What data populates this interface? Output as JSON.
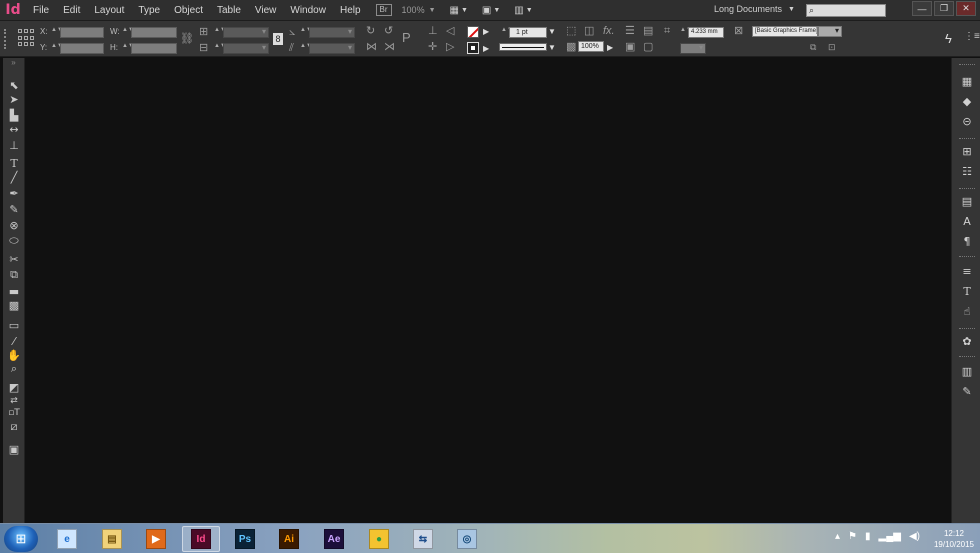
{
  "app": {
    "logo": "Id",
    "menu": [
      "File",
      "Edit",
      "Layout",
      "Type",
      "Object",
      "Table",
      "View",
      "Window",
      "Help"
    ],
    "bridge_label": "Br",
    "zoom": "100%",
    "workspace": "Long Documents",
    "search_placeholder": ""
  },
  "controlbar": {
    "x_label": "X:",
    "y_label": "Y:",
    "w_label": "W:",
    "h_label": "H:",
    "stroke_weight": "1 pt",
    "opacity": "100%",
    "fitting_value": "4.233 mm",
    "object_style": "[Basic Graphics Frame]"
  },
  "window_controls": {
    "minimize": "—",
    "restore": "❐",
    "close": "✕"
  },
  "taskbar": {
    "apps": [
      {
        "name": "internet-explorer",
        "label": "e",
        "color": "#1e6fd0",
        "bg": "#cfe6ff"
      },
      {
        "name": "file-explorer",
        "label": "▤",
        "color": "#7a5a12",
        "bg": "#f1d27a"
      },
      {
        "name": "media-player",
        "label": "▶",
        "color": "#ffffff",
        "bg": "#e06a1b"
      },
      {
        "name": "indesign",
        "label": "Id",
        "color": "#ff4a8d",
        "bg": "#4a0a27"
      },
      {
        "name": "photoshop",
        "label": "Ps",
        "color": "#5fc4ff",
        "bg": "#0a2236"
      },
      {
        "name": "illustrator",
        "label": "Ai",
        "color": "#ff9a00",
        "bg": "#3a1a00"
      },
      {
        "name": "after-effects",
        "label": "Ae",
        "color": "#c9a4ff",
        "bg": "#1c0f3a"
      },
      {
        "name": "chrome",
        "label": "●",
        "color": "#2f9d44",
        "bg": "#f4c330"
      },
      {
        "name": "network-app",
        "label": "⇆",
        "color": "#1f4e8c",
        "bg": "#cfd8e6"
      },
      {
        "name": "browser-app",
        "label": "◎",
        "color": "#164a7a",
        "bg": "#a9c6e2"
      }
    ],
    "time": "12:12",
    "date": "19/10/2015"
  }
}
